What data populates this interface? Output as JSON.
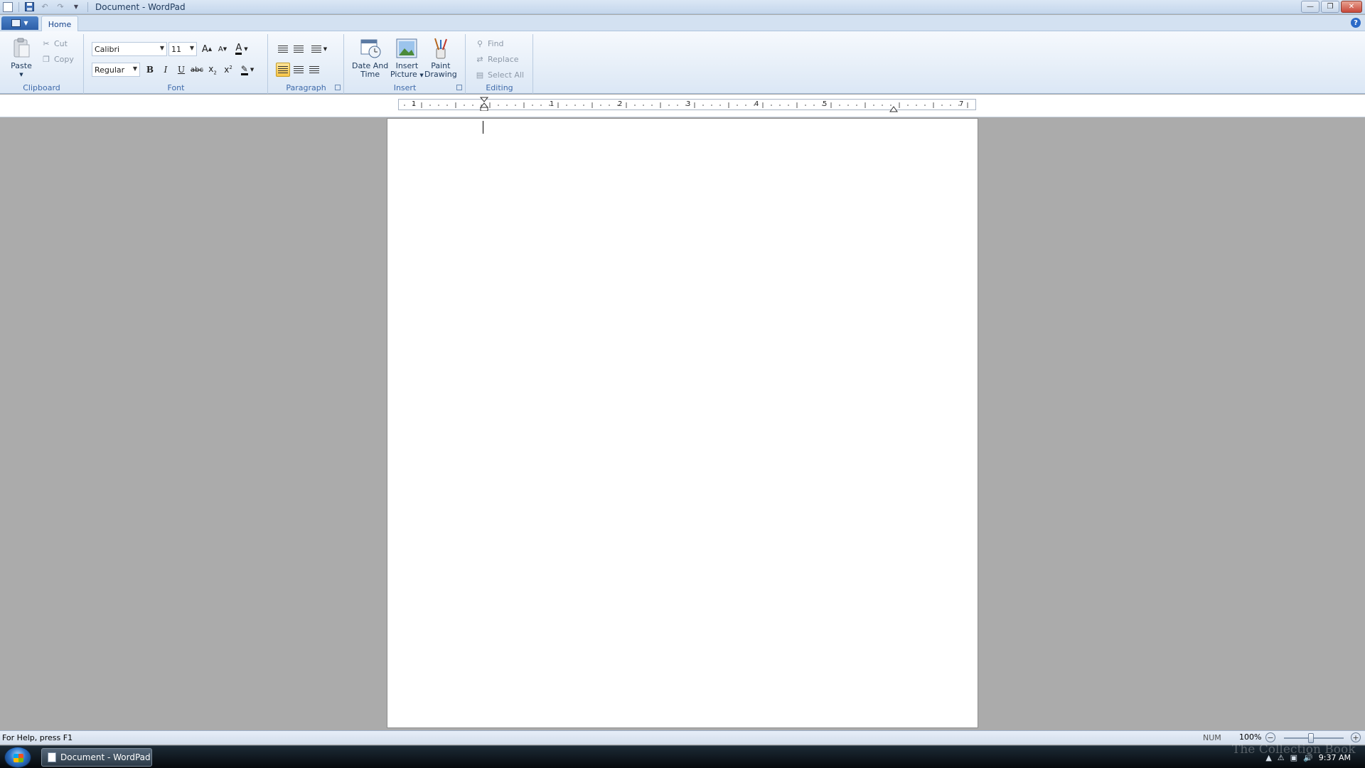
{
  "window": {
    "title": "Document - WordPad",
    "min_glyph": "—",
    "max_glyph": "❐",
    "close_glyph": "✕"
  },
  "quick_access": {
    "save_icon": "save-icon",
    "undo_icon": "undo-icon",
    "redo_icon": "redo-icon",
    "customize_icon": "dropdown-arrow-icon"
  },
  "tabs": {
    "home_label": "Home",
    "help_glyph": "?"
  },
  "ribbon": {
    "clipboard": {
      "label": "Clipboard",
      "paste_label": "Paste",
      "cut_label": "Cut",
      "copy_label": "Copy"
    },
    "font": {
      "label": "Font",
      "family": "Calibri",
      "size": "11",
      "style": "Regular",
      "bold": "B",
      "italic": "I",
      "underline": "U",
      "strikethrough": "abc",
      "grow_font": "A",
      "shrink_font": "A"
    },
    "paragraph": {
      "label": "Paragraph",
      "active_alignment": "left"
    },
    "insert": {
      "label": "Insert",
      "date_time_label_1": "Date And",
      "date_time_label_2": "Time",
      "picture_label_1": "Insert",
      "picture_label_2": "Picture",
      "paint_label_1": "Paint",
      "paint_label_2": "Drawing"
    },
    "editing": {
      "label": "Editing",
      "find_label": "Find",
      "replace_label": "Replace",
      "select_all_label": "Select All"
    }
  },
  "ruler": {
    "numbers": [
      "1",
      "1",
      "2",
      "3",
      "4",
      "5",
      "7"
    ]
  },
  "status": {
    "help_text": "For Help, press F1",
    "num": "NUM",
    "zoom": "100%",
    "zoom_out_glyph": "−",
    "zoom_in_glyph": "+",
    "zoom_fraction": 0.45
  },
  "taskbar": {
    "window_label": "Document - WordPad",
    "clock": "9:37 AM",
    "watermark": "The Collection Book"
  },
  "colors": {
    "ribbon_bg": "#dbe7f5",
    "accent": "#2c5ea8",
    "active_button": "#f9c649",
    "workspace": "#ababab"
  }
}
